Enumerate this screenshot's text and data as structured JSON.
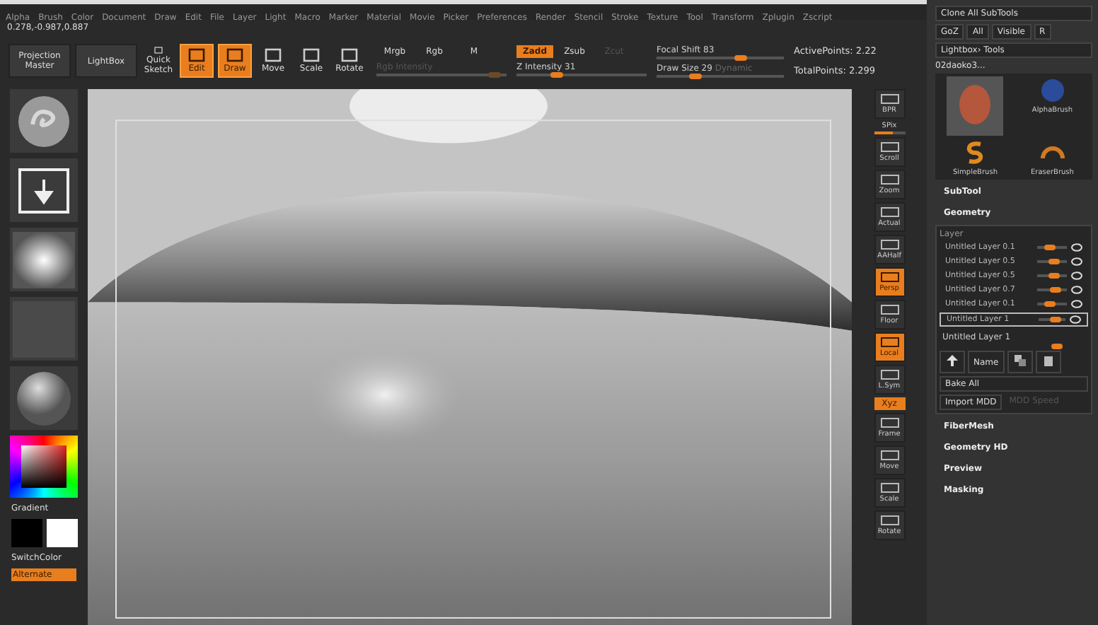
{
  "menu": [
    "Alpha",
    "Brush",
    "Color",
    "Document",
    "Draw",
    "Edit",
    "File",
    "Layer",
    "Light",
    "Macro",
    "Marker",
    "Material",
    "Movie",
    "Picker",
    "Preferences",
    "Render",
    "Stencil",
    "Stroke",
    "Texture",
    "Tool",
    "Transform",
    "Zplugin",
    "Zscript"
  ],
  "coordinates": "0.278,-0.987,0.887",
  "toolbar": {
    "left_buttons": [
      {
        "label": "Projection Master",
        "kind": "text",
        "selected": false
      },
      {
        "label": "LightBox",
        "kind": "text",
        "selected": false
      },
      {
        "label": "Quick Sketch",
        "kind": "icon",
        "selected": false
      },
      {
        "label": "Edit",
        "kind": "icon",
        "selected": true
      },
      {
        "label": "Draw",
        "kind": "icon",
        "selected": true
      },
      {
        "label": "Move",
        "kind": "icon",
        "selected": false
      },
      {
        "label": "Scale",
        "kind": "icon",
        "selected": false
      },
      {
        "label": "Rotate",
        "kind": "icon",
        "selected": false
      }
    ],
    "color_modes": [
      {
        "label": "Mrgb",
        "selected": false
      },
      {
        "label": "Rgb",
        "selected": false
      },
      {
        "label": "M",
        "selected": false
      }
    ],
    "rgb_intensity": {
      "label": "Rgb Intensity",
      "level": 0.9,
      "disabled": true
    },
    "z_modes": [
      {
        "label": "Zadd",
        "selected": true,
        "disabled": false
      },
      {
        "label": "Zsub",
        "selected": false,
        "disabled": false
      },
      {
        "label": "Zcut",
        "selected": false,
        "disabled": true
      }
    ],
    "z_intensity": {
      "label": "Z Intensity 31",
      "level": 0.3
    },
    "focal_shift": {
      "label": "Focal Shift 83",
      "level": 0.65
    },
    "draw_size": {
      "label": "Draw Size 29",
      "level": 0.3
    },
    "dynamic": "Dynamic",
    "active_points": "ActivePoints: 2.22",
    "total_points": "TotalPoints: 2.299"
  },
  "left_shelf": {
    "tiles": [
      {
        "kind": "brush"
      },
      {
        "kind": "stroke"
      },
      {
        "kind": "alpha"
      },
      {
        "kind": "texture"
      },
      {
        "kind": "material"
      }
    ],
    "gradient": "Gradient",
    "switch_color": "SwitchColor",
    "alternate": {
      "label": "Alternate",
      "on": true
    }
  },
  "right_shelf": [
    {
      "label": "BPR",
      "kind": "button",
      "on": false
    },
    {
      "label": "SPix",
      "kind": "slider",
      "level": 0.6
    },
    {
      "label": "Scroll",
      "kind": "button",
      "on": false
    },
    {
      "label": "Zoom",
      "kind": "button",
      "on": false
    },
    {
      "label": "Actual",
      "kind": "button",
      "on": false
    },
    {
      "label": "AAHalf",
      "kind": "button",
      "on": false
    },
    {
      "label": "Persp",
      "kind": "button",
      "on": true
    },
    {
      "label": "Floor",
      "kind": "button",
      "on": false
    },
    {
      "label": "Local",
      "kind": "button",
      "on": true
    },
    {
      "label": "L.Sym",
      "kind": "button",
      "on": false
    },
    {
      "label": "Xyz",
      "kind": "toggle",
      "on": true
    },
    {
      "label": "Frame",
      "kind": "button",
      "on": false
    },
    {
      "label": "Move",
      "kind": "button",
      "on": false
    },
    {
      "label": "Scale",
      "kind": "button",
      "on": false
    },
    {
      "label": "Rotate",
      "kind": "button",
      "on": false
    }
  ],
  "tool_panel": {
    "clone_all": "Clone All SubTools",
    "row": [
      "GoZ",
      "All",
      "Visible",
      "R"
    ],
    "lightbox_tools": "Lightbox› Tools",
    "tool_name": "02daoko3...",
    "brushes": [
      {
        "label": "AlphaBrush",
        "kind": "alpha"
      },
      {
        "label": "SimpleBrush",
        "kind": "simple"
      },
      {
        "label": "EraserBrush",
        "kind": "eraser"
      }
    ],
    "sections": [
      "SubTool",
      "Geometry"
    ],
    "layer_title": "Layer",
    "layers": [
      {
        "name": "Untitled Layer",
        "value": "0.1",
        "level": 0.45,
        "visible": true,
        "selected": false
      },
      {
        "name": "Untitled Layer",
        "value": "0.5",
        "level": 0.55,
        "visible": true,
        "selected": false
      },
      {
        "name": "Untitled Layer",
        "value": "0.5",
        "level": 0.55,
        "visible": true,
        "selected": false
      },
      {
        "name": "Untitled Layer",
        "value": "0.7",
        "level": 0.6,
        "visible": true,
        "selected": false
      },
      {
        "name": "Untitled Layer",
        "value": "0.1",
        "level": 0.45,
        "visible": true,
        "selected": false
      },
      {
        "name": "Untitled Layer",
        "value": "1",
        "level": 0.65,
        "visible": true,
        "selected": true
      }
    ],
    "layer_name": "Untitled Layer 1",
    "name_button": "Name",
    "bake_all": "Bake All",
    "import_mdd": "Import MDD",
    "mdd_speed": {
      "label": "MDD Speed",
      "disabled": true
    },
    "menu_sections": [
      "FiberMesh",
      "Geometry HD",
      "Preview",
      "Masking"
    ]
  }
}
